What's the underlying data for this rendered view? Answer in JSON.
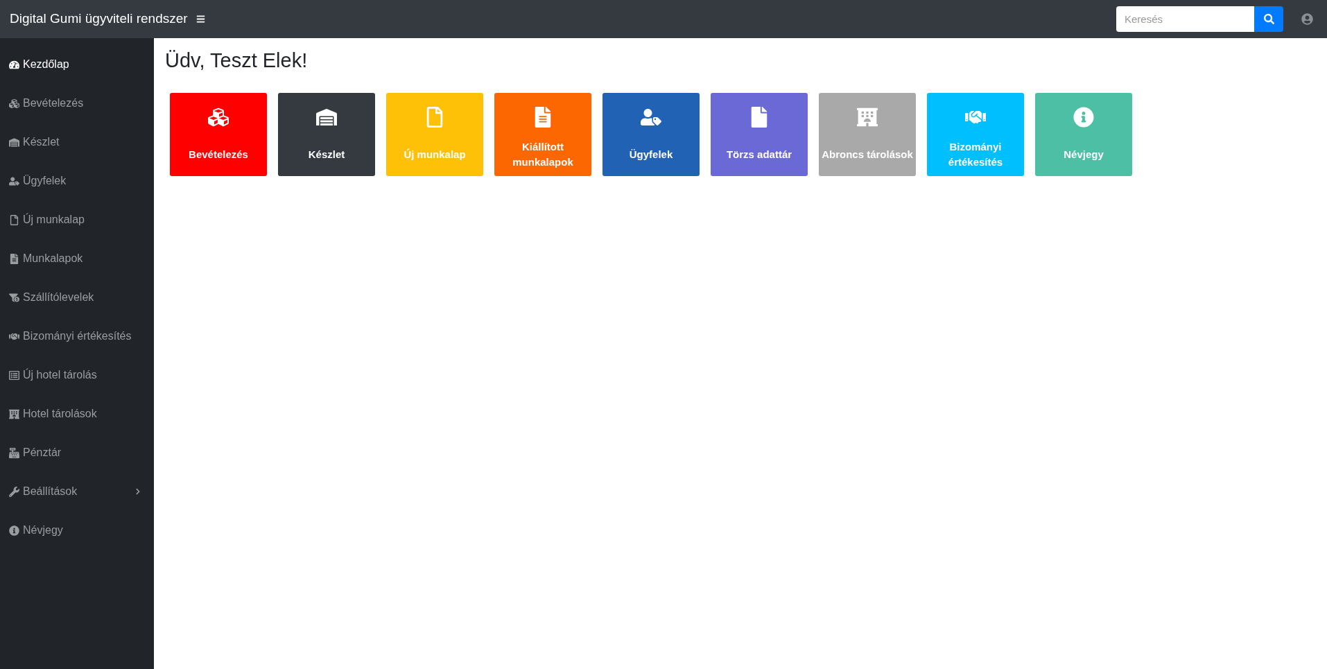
{
  "navbar": {
    "brand": "Digital Gumi ügyviteli rendszer",
    "search": {
      "placeholder": "Keresés"
    }
  },
  "sidebar": {
    "items": [
      {
        "label": "Kezdőlap",
        "selected": true
      },
      {
        "label": "Bevételezés",
        "selected": false
      },
      {
        "label": "Készlet",
        "selected": false
      },
      {
        "label": "Ügyfelek",
        "selected": false
      },
      {
        "label": "Új munkalap",
        "selected": false
      },
      {
        "label": "Munkalapok",
        "selected": false
      },
      {
        "label": "Szállítólevelek",
        "selected": false
      },
      {
        "label": "Bizományi értékesítés",
        "selected": false
      },
      {
        "label": "Új hotel tárolás",
        "selected": false
      },
      {
        "label": "Hotel tárolások",
        "selected": false
      },
      {
        "label": "Pénztár",
        "selected": false
      },
      {
        "label": "Beállítások",
        "selected": false,
        "expanded": false
      },
      {
        "label": "Névjegy",
        "selected": false
      }
    ]
  },
  "heading": "Üdv, Teszt Elek!",
  "tiles": [
    {
      "label": "Bevételezés",
      "color": "#ff0000"
    },
    {
      "label": "Készlet",
      "color": "#343a40"
    },
    {
      "label": "Új munkalap",
      "color": "#ffc107"
    },
    {
      "label": "Kiállított munkalapok",
      "color": "#fd6702"
    },
    {
      "label": "Ügyfelek",
      "color": "#2262b4"
    },
    {
      "label": "Törzs adattár",
      "color": "#6b69d6"
    },
    {
      "label": "Abroncs tárolások",
      "color": "#a9a9a9"
    },
    {
      "label": "Bizományi értékesítés",
      "color": "#00bfff"
    },
    {
      "label": "Névjegy",
      "color": "#4dbfa5"
    }
  ]
}
